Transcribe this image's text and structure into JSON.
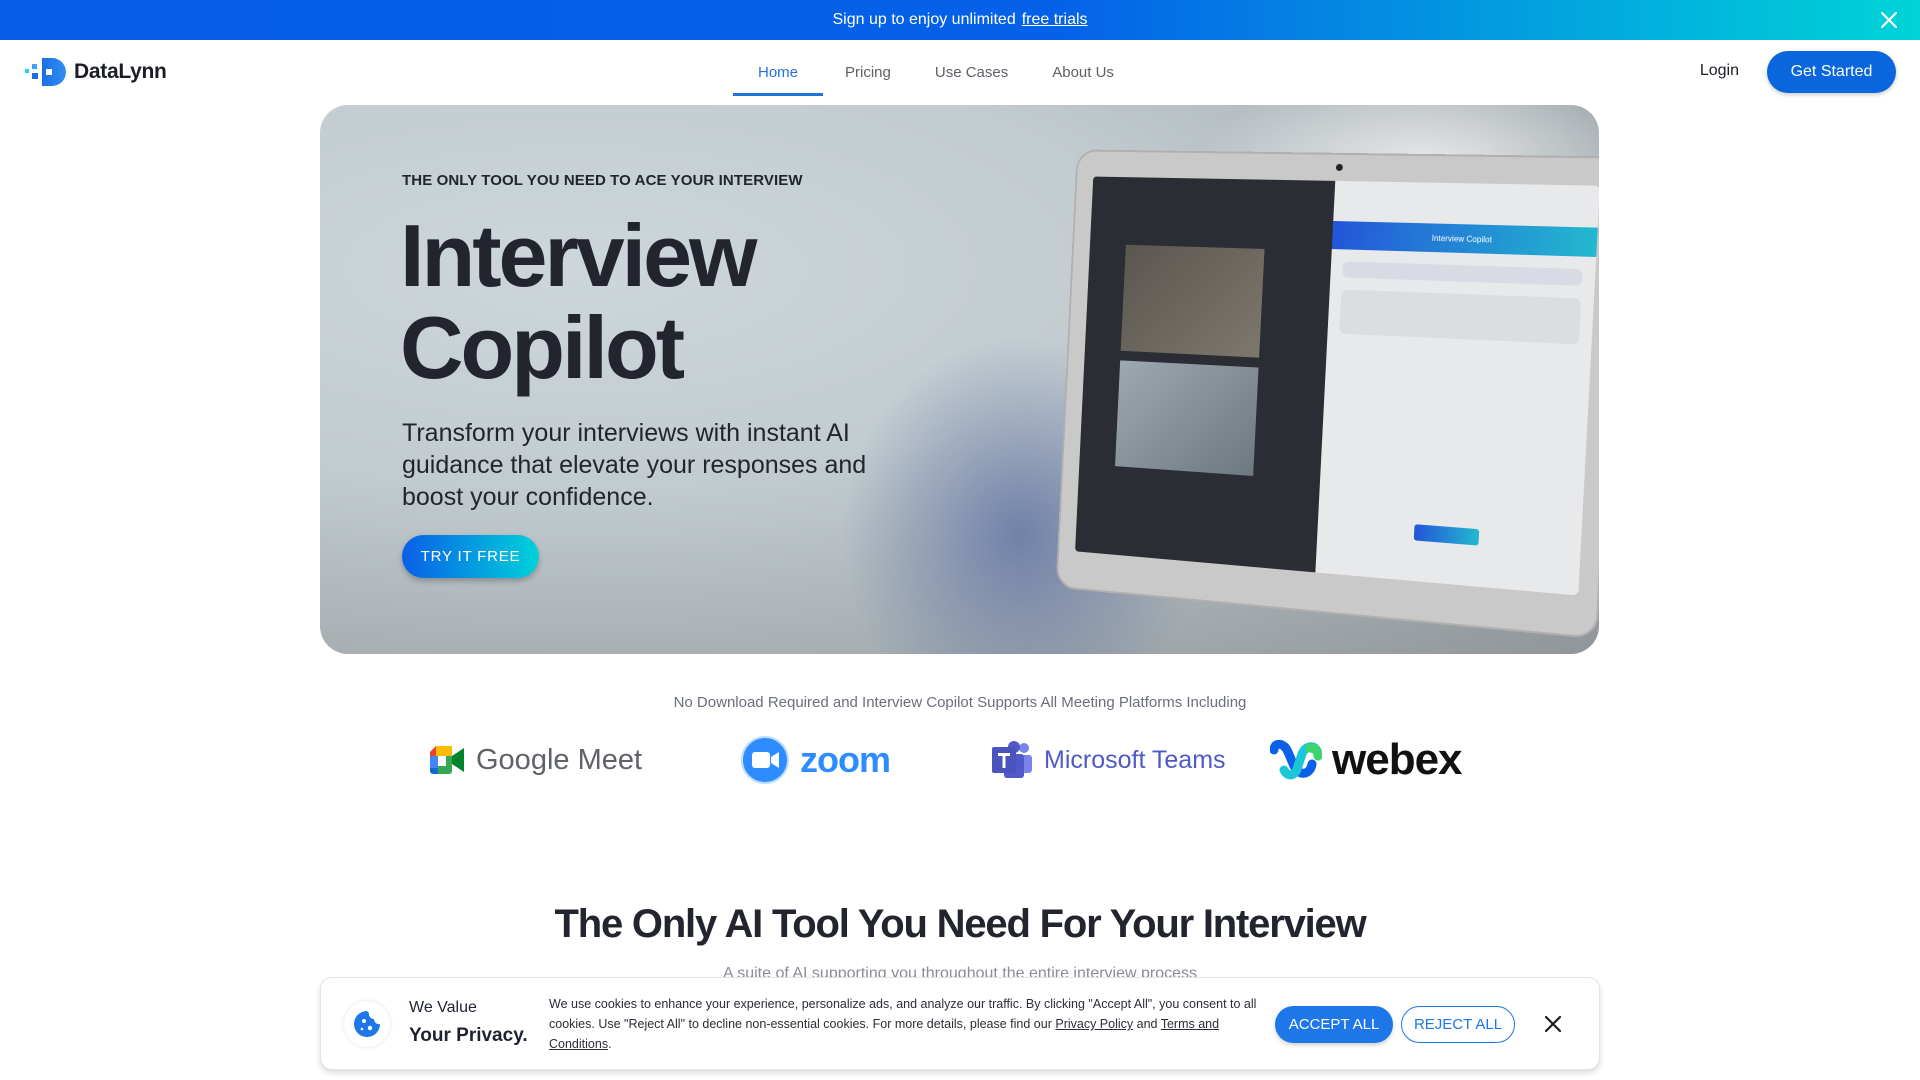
{
  "promo": {
    "text": "Sign up to enjoy unlimited",
    "link": "free trials",
    "close_icon": "close-icon"
  },
  "nav": {
    "brand": "DataLynn",
    "items": [
      {
        "label": "Home",
        "active": true
      },
      {
        "label": "Pricing",
        "active": false
      },
      {
        "label": "Use Cases",
        "active": false
      },
      {
        "label": "About Us",
        "active": false
      }
    ],
    "login": "Login",
    "cta": "Get Started"
  },
  "hero": {
    "eyebrow": "THE ONLY TOOL YOU NEED TO ACE YOUR INTERVIEW",
    "title_line1": "Interview",
    "title_line2": "Copilot",
    "subtitle": "Transform your interviews with instant AI guidance that elevate your responses and boost your confidence.",
    "cta": "TRY IT FREE",
    "screen_panel_title": "Interview Copilot"
  },
  "platforms": {
    "caption": "No Download Required and Interview Copilot Supports All Meeting Platforms Including",
    "items": [
      {
        "name": "Google Meet",
        "icon": "google-meet-icon"
      },
      {
        "name": "zoom",
        "icon": "zoom-icon"
      },
      {
        "name": "Microsoft Teams",
        "icon": "microsoft-teams-icon"
      },
      {
        "name": "webex",
        "icon": "webex-icon"
      }
    ]
  },
  "section": {
    "title": "The Only AI Tool You Need For Your Interview",
    "subtitle": "A suite of AI supporting you throughout the entire interview process"
  },
  "cookie": {
    "heading1": "We Value",
    "heading2": "Your Privacy.",
    "text_part1": "We use cookies to enhance your experience, personalize ads, and analyze our traffic. By clicking \"Accept All\", you consent to all cookies. Use \"Reject All\" to decline non-essential cookies. For more details, please find our ",
    "privacy_link": "Privacy Policy",
    "text_part2": " and ",
    "terms_link": "Terms and Conditions",
    "text_part3": ".",
    "accept": "ACCEPT ALL",
    "reject": "REJECT ALL"
  },
  "colors": {
    "brand_blue": "#0a66dd",
    "accent_cyan": "#00d2d8",
    "active_nav": "#1f74d8"
  }
}
